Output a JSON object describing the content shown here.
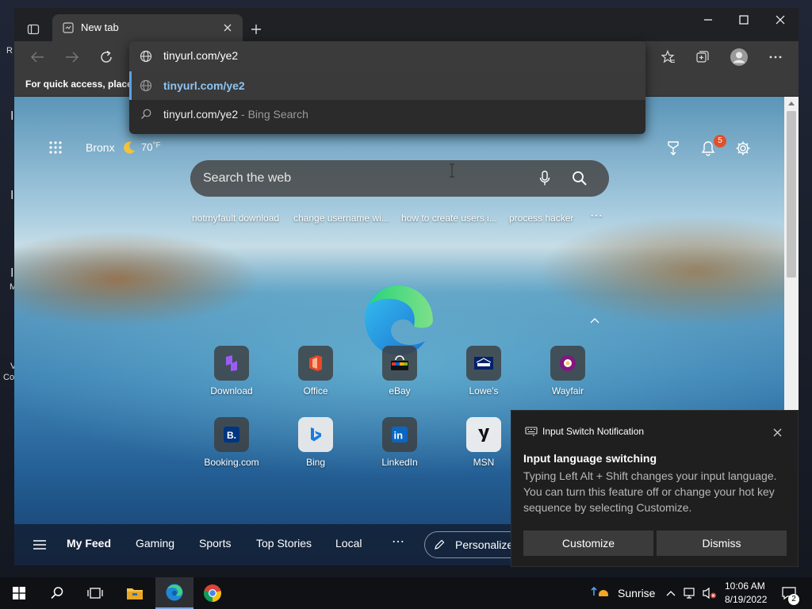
{
  "desktop": {
    "edge_letters": [
      "R",
      "I",
      "I",
      "I",
      "M",
      "V",
      "Co"
    ]
  },
  "browser": {
    "tab": {
      "title": "New tab"
    },
    "favorites_bar": {
      "text": "For quick access, place y"
    },
    "address": {
      "value": "tinyurl.com/ye2",
      "suggestions": [
        {
          "text": "tinyurl.com/ye2",
          "suffix": ""
        },
        {
          "text": "tinyurl.com/ye2",
          "suffix": " - Bing Search"
        }
      ]
    }
  },
  "newtab": {
    "location": "Bronx",
    "temperature": "70",
    "temperature_unit": "°F",
    "notification_count": "5",
    "search_placeholder": "Search the web",
    "trending": [
      "notmyfault download",
      "change username wi...",
      "how to create users i...",
      "process hacker",
      "⋯"
    ],
    "quick_links_row1": [
      {
        "label": "Download",
        "icon": "download-icon"
      },
      {
        "label": "Office",
        "icon": "office-icon"
      },
      {
        "label": "eBay",
        "icon": "ebay-icon"
      },
      {
        "label": "Lowe's",
        "icon": "lowes-icon"
      },
      {
        "label": "Wayfair",
        "icon": "wayfair-icon"
      }
    ],
    "quick_links_row2": [
      {
        "label": "Booking.com",
        "icon": "booking-icon"
      },
      {
        "label": "Bing",
        "icon": "bing-icon"
      },
      {
        "label": "LinkedIn",
        "icon": "linkedin-icon"
      },
      {
        "label": "MSN",
        "icon": "msn-icon"
      }
    ],
    "feed_tabs": [
      "My Feed",
      "Gaming",
      "Sports",
      "Top Stories",
      "Local",
      "⋯"
    ],
    "personalize_label": "Personalize"
  },
  "toast": {
    "header": "Input Switch Notification",
    "title": "Input language switching",
    "body": "Typing Left Alt + Shift changes your input language. You can turn this feature off or change your hot key sequence by selecting Customize.",
    "customize_label": "Customize",
    "dismiss_label": "Dismiss"
  },
  "taskbar": {
    "weather_text": "Sunrise",
    "time": "10:06 AM",
    "date": "8/19/2022",
    "notification_count": "2"
  },
  "colors": {
    "accent": "#5aa0e6",
    "badge": "#e0502a",
    "toast_button": "#3b3b3b"
  }
}
